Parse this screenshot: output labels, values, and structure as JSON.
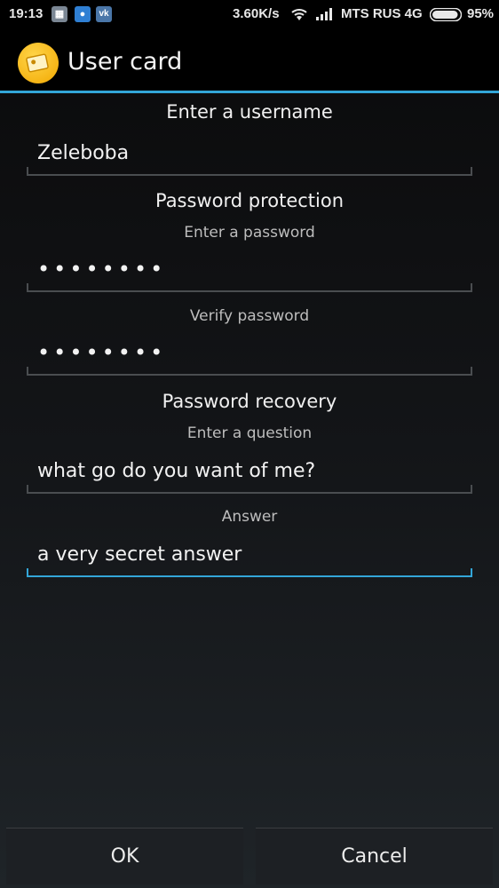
{
  "status_bar": {
    "time": "19:13",
    "speed": "3.60K/s",
    "carrier": "MTS RUS 4G",
    "battery": "95%",
    "battery_level": 0.95,
    "icons": [
      "notification-app-icon",
      "messaging-app-icon",
      "vk-icon",
      "wifi-icon",
      "signal-icon",
      "battery-icon"
    ],
    "vk_label": "vk"
  },
  "action_bar": {
    "title": "User card",
    "icon": "wallet-app-icon",
    "accent_color": "#33a6d8"
  },
  "form": {
    "username": {
      "title": "Enter a username",
      "value": "Zeleboba"
    },
    "password_protection": {
      "title": "Password protection",
      "password_label": "Enter a password",
      "password_value": "••••••••",
      "verify_label": "Verify password",
      "verify_value": "••••••••"
    },
    "password_recovery": {
      "title": "Password recovery",
      "question_label": "Enter a question",
      "question_value": "what go do you want of me?",
      "answer_label": "Answer",
      "answer_value": "a very secret answer"
    }
  },
  "buttons": {
    "ok": "OK",
    "cancel": "Cancel"
  }
}
